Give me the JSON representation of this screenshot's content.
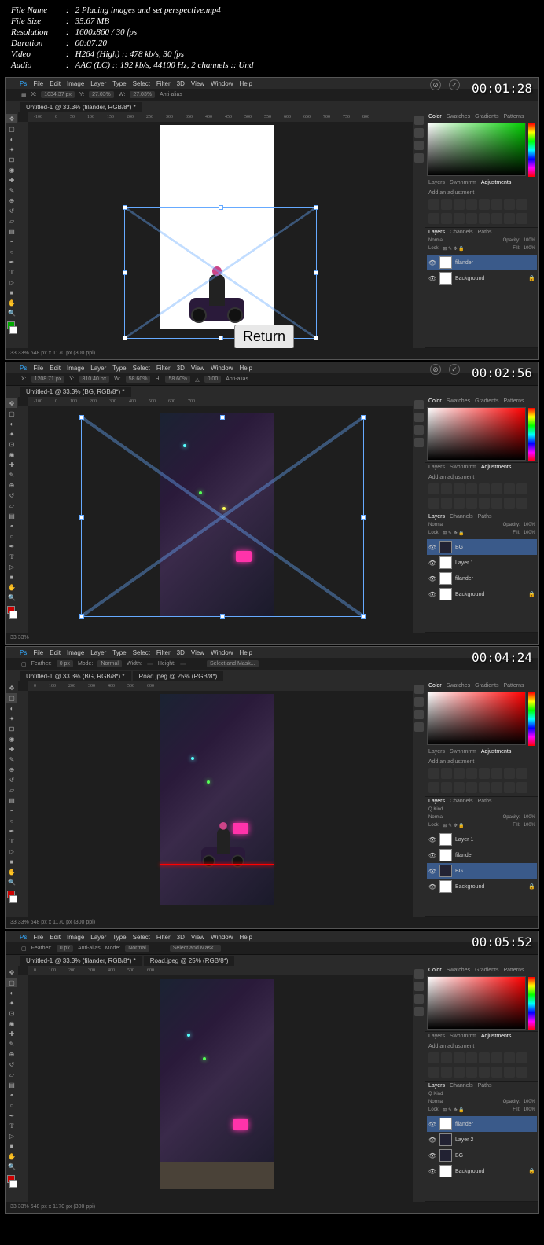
{
  "header": {
    "filename_label": "File Name",
    "filename": "2 Placing images and set perspective.mp4",
    "filesize_label": "File Size",
    "filesize": "35.67 MB",
    "resolution_label": "Resolution",
    "resolution": "1600x860 / 30 fps",
    "duration_label": "Duration",
    "duration": "00:07:20",
    "video_label": "Video",
    "video": "H264 (High) :: 478 kb/s, 30 fps",
    "audio_label": "Audio",
    "audio": "AAC (LC) :: 192 kb/s, 44100 Hz, 2 channels :: Und",
    "sep": ":"
  },
  "menu": [
    "File",
    "Edit",
    "Image",
    "Layer",
    "Type",
    "Select",
    "Filter",
    "3D",
    "View",
    "Window",
    "Help"
  ],
  "frames": [
    {
      "timestamp": "00:01:28",
      "doc_tab": "Untitled-1 @ 33.3% (filander, RGB/8*) *",
      "optbar": {
        "x": "1034.37 px",
        "y": "27.03%",
        "w": "27.03%",
        "antialias": "Anti-alias"
      },
      "status": "33.33%    648 px x 1170 px (300 ppi)",
      "return_label": "Return",
      "panels": {
        "color_tabs": [
          "Color",
          "Swatches",
          "Gradients",
          "Patterns"
        ],
        "adj_tabs": [
          "Layers",
          "Swhnmrrm",
          "Adjustments"
        ],
        "adj_label": "Add an adjustment",
        "layer_tabs": [
          "Layers",
          "Channels",
          "Paths"
        ],
        "blend": "Normal",
        "opacity_label": "Opacity:",
        "opacity": "100%",
        "lock_label": "Lock:",
        "fill_label": "Fill:",
        "fill": "100%",
        "layers": [
          {
            "name": "filander",
            "selected": true,
            "thumb": "white"
          },
          {
            "name": "Background",
            "selected": false,
            "thumb": "white",
            "locked": true
          }
        ]
      }
    },
    {
      "timestamp": "00:02:56",
      "doc_tab": "Untitled-1 @ 33.3% (BG, RGB/8*) *",
      "optbar": {
        "x": "1208.71 px",
        "y": "810.40 px",
        "w": "58.60%",
        "h": "58.60%",
        "rot": "0.00",
        "antialias": "Anti-alias"
      },
      "status": "33.33%",
      "panels": {
        "color_tabs": [
          "Color",
          "Swatches",
          "Gradients",
          "Patterns"
        ],
        "adj_tabs": [
          "Layers",
          "Swhnmrrm",
          "Adjustments"
        ],
        "adj_label": "Add an adjustment",
        "layer_tabs": [
          "Layers",
          "Channels",
          "Paths"
        ],
        "blend": "Normal",
        "opacity_label": "Opacity:",
        "opacity": "100%",
        "lock_label": "Lock:",
        "fill_label": "Fill:",
        "fill": "100%",
        "layers": [
          {
            "name": "BG",
            "selected": true,
            "thumb": "dark"
          },
          {
            "name": "Layer 1",
            "selected": false,
            "thumb": "white"
          },
          {
            "name": "filander",
            "selected": false,
            "thumb": "white"
          },
          {
            "name": "Background",
            "selected": false,
            "thumb": "white",
            "locked": true
          }
        ]
      }
    },
    {
      "timestamp": "00:04:24",
      "doc_tab": "Untitled-1 @ 33.3% (BG, RGB/8*) *",
      "doc_tab2": "Road.jpeg @ 25% (RGB/8*)",
      "optbar": {
        "feather_label": "Feather:",
        "feather": "0 px",
        "mode_label": "Mode:",
        "mode": "Normal",
        "width_label": "Width:",
        "height_label": "Height:",
        "button": "Select and Mask..."
      },
      "status": "33.33%    648 px x 1170 px (300 ppi)",
      "panels": {
        "color_tabs": [
          "Color",
          "Swatches",
          "Gradients",
          "Patterns"
        ],
        "adj_tabs": [
          "Layers",
          "Swhnmrrm",
          "Adjustments"
        ],
        "adj_label": "Add an adjustment",
        "layer_tabs": [
          "Layers",
          "Channels",
          "Paths"
        ],
        "kind_label": "Q Kind",
        "blend": "Normal",
        "opacity_label": "Opacity:",
        "opacity": "100%",
        "lock_label": "Lock:",
        "fill_label": "Fill:",
        "fill": "100%",
        "layers": [
          {
            "name": "Layer 1",
            "selected": false,
            "thumb": "white"
          },
          {
            "name": "filander",
            "selected": false,
            "thumb": "white"
          },
          {
            "name": "BG",
            "selected": true,
            "thumb": "dark"
          },
          {
            "name": "Background",
            "selected": false,
            "thumb": "white",
            "locked": true
          }
        ]
      }
    },
    {
      "timestamp": "00:05:52",
      "doc_tab": "Untitled-1 @ 33.3% (filander, RGB/8*) *",
      "doc_tab2": "Road.jpeg @ 25% (RGB/8*)",
      "optbar": {
        "feather_label": "Feather:",
        "feather": "0 px",
        "antialias": "Anti-alias",
        "mode_label": "Mode:",
        "mode": "Normal",
        "button": "Select and Mask..."
      },
      "status": "33.33%    648 px x 1170 px (300 ppi)",
      "panels": {
        "color_tabs": [
          "Color",
          "Swatches",
          "Gradients",
          "Patterns"
        ],
        "adj_tabs": [
          "Layers",
          "Swhnmrrm",
          "Adjustments"
        ],
        "adj_label": "Add an adjustment",
        "layer_tabs": [
          "Layers",
          "Channels",
          "Paths"
        ],
        "kind_label": "Q Kind",
        "blend": "Normal",
        "opacity_label": "Opacity:",
        "opacity": "100%",
        "lock_label": "Lock:",
        "fill_label": "Fill:",
        "fill": "100%",
        "layers": [
          {
            "name": "filander",
            "selected": true,
            "thumb": "white"
          },
          {
            "name": "Layer 2",
            "selected": false,
            "thumb": "dark"
          },
          {
            "name": "BG",
            "selected": false,
            "thumb": "dark"
          },
          {
            "name": "Background",
            "selected": false,
            "thumb": "white",
            "locked": true
          }
        ]
      }
    }
  ]
}
